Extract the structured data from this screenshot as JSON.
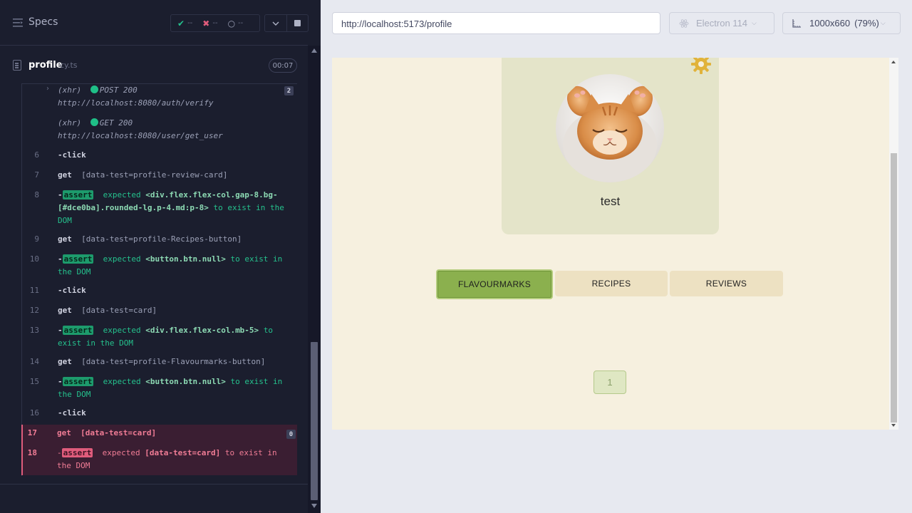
{
  "sidebar": {
    "specs_label": "Specs",
    "stats": {
      "passed": "--",
      "failed": "--",
      "pending": "--"
    },
    "file": {
      "name": "profile",
      "ext": "cy.ts",
      "duration": "00:07"
    }
  },
  "log": {
    "xhr1": {
      "prefix": "(xhr)",
      "status": "POST 200",
      "url": "http://localhost:8080/auth/verify",
      "count": "2"
    },
    "xhr2": {
      "prefix": "(xhr)",
      "status": "GET 200",
      "url": "http://localhost:8080/user/get_user"
    },
    "c6": {
      "num": "6",
      "name": "-click"
    },
    "c7": {
      "num": "7",
      "name": "get",
      "selector": "[data-test=profile-review-card]"
    },
    "c8": {
      "num": "8",
      "dash": "-",
      "badge": "assert",
      "expected": "expected",
      "subject": "<div.flex.flex-col.gap-8.bg-[#dce0ba].rounded-lg.p-4.md:p-8>",
      "rest": "to exist in the DOM"
    },
    "c9": {
      "num": "9",
      "name": "get",
      "selector": "[data-test=profile-Recipes-button]"
    },
    "c10": {
      "num": "10",
      "dash": "-",
      "badge": "assert",
      "expected": "expected",
      "subject": "<button.btn.null>",
      "rest": "to exist in the DOM"
    },
    "c11": {
      "num": "11",
      "name": "-click"
    },
    "c12": {
      "num": "12",
      "name": "get",
      "selector": "[data-test=card]"
    },
    "c13": {
      "num": "13",
      "dash": "-",
      "badge": "assert",
      "expected": "expected",
      "subject": "<div.flex.flex-col.mb-5>",
      "rest": "to exist in the DOM"
    },
    "c14": {
      "num": "14",
      "name": "get",
      "selector": "[data-test=profile-Flavourmarks-button]"
    },
    "c15": {
      "num": "15",
      "dash": "-",
      "badge": "assert",
      "expected": "expected",
      "subject": "<button.btn.null>",
      "rest": "to exist in the DOM"
    },
    "c16": {
      "num": "16",
      "name": "-click"
    },
    "c17": {
      "num": "17",
      "name": "get",
      "selector": "[data-test=card]",
      "count": "0"
    },
    "c18": {
      "num": "18",
      "dash": "-",
      "badge": "assert",
      "expected": "expected",
      "subject": "[data-test=card]",
      "rest": "to exist in the DOM"
    }
  },
  "preview": {
    "url": "http://localhost:5173/profile",
    "browser": "Electron 114",
    "viewport": "1000x660",
    "zoom": "(79%)"
  },
  "app": {
    "username": "test",
    "tabs": [
      "FLAVOURMARKS",
      "RECIPES",
      "REVIEWS"
    ],
    "active_tab": "FLAVOURMARKS",
    "page": "1"
  },
  "colors": {
    "runner_bg": "#1b1e2e",
    "pass_green": "#25c18d",
    "fail_red": "#e05c7c",
    "app_bg": "#f6f0df",
    "active_tab": "#8bb04e",
    "gear": "#e1b33b"
  },
  "icons": [
    "menu-icon",
    "check-icon",
    "x-icon",
    "spinner-icon",
    "chevron-down-icon",
    "stop-icon",
    "file-icon",
    "electron-icon",
    "viewport-icon",
    "gear-icon"
  ]
}
